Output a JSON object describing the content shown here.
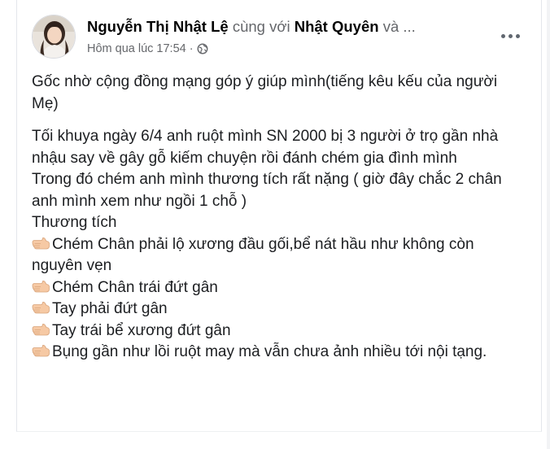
{
  "post": {
    "author": "Nguyễn Thị Nhật Lệ",
    "with_text": "cùng với",
    "tagged": "Nhật Quyên",
    "and_more": "và ...",
    "timestamp": "Hôm qua lúc 17:54",
    "dot": "·",
    "audience_icon": "globe-icon",
    "more_icon": "more-options-icon",
    "paragraphs": [
      "Gốc nhờ cộng đồng mạng góp ý giúp mình(tiếng kêu kếu của người Mẹ)",
      "Tối khuya ngày 6/4 anh ruột mình SN 2000 bị 3 người ở trọ gần nhà nhậu say về gây gỗ kiếm chuyện rồi đánh chém gia đình mình",
      "Trong đó chém anh mình thương tích rất nặng ( giờ đây chắc 2 chân anh mình xem như ngồi 1 chỗ )",
      "Thương tích"
    ],
    "bullets": [
      "Chém Chân phải lộ xương đầu gối,bể nát hầu như không còn nguyên vẹn",
      "Chém Chân trái đứt gân",
      "Tay phải đứt gân",
      "Tay trái bể xương đứt gân",
      "Bụng gần như lồi ruột may mà vẫn chưa ảnh nhiều tới nội tạng."
    ],
    "bullet_icon": "pointing-hand-icon"
  },
  "colors": {
    "text": "#050505",
    "muted": "#65676b",
    "skin": "#f6c9a4"
  }
}
